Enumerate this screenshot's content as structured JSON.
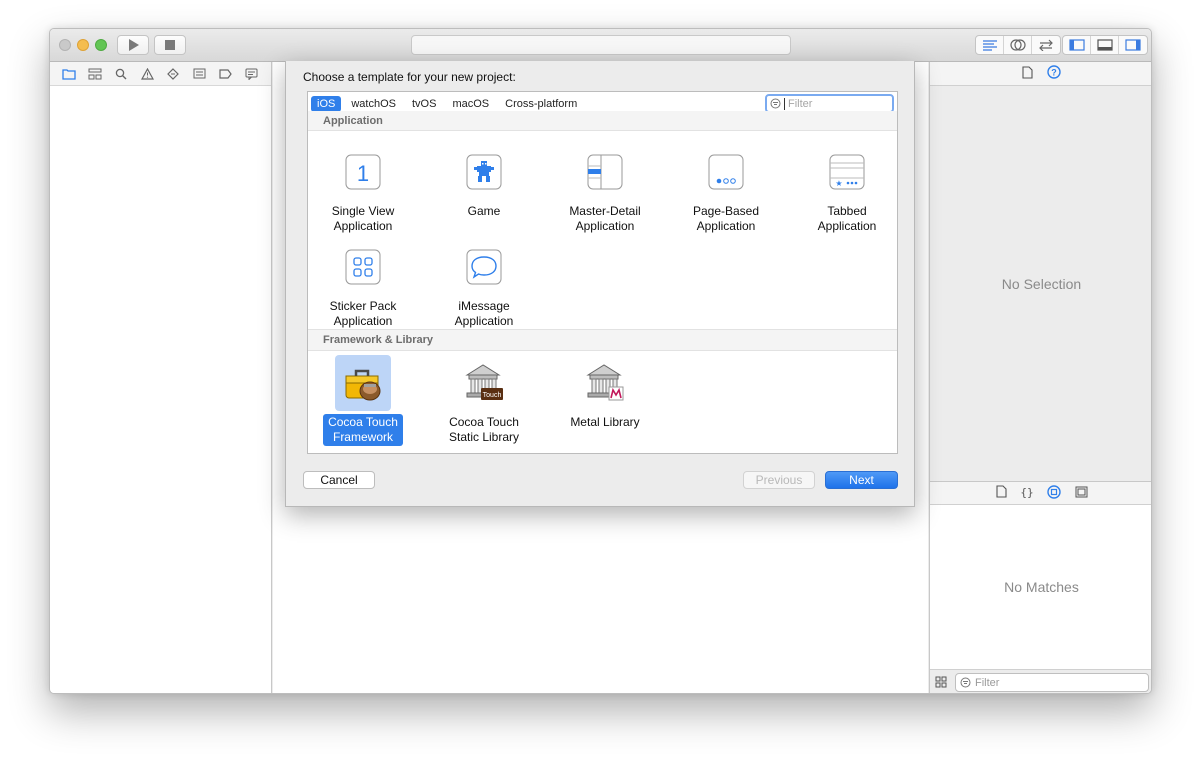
{
  "sheet": {
    "title": "Choose a template for your new project:",
    "tabs": [
      {
        "label": "iOS",
        "active": true
      },
      {
        "label": "watchOS",
        "active": false
      },
      {
        "label": "tvOS",
        "active": false
      },
      {
        "label": "macOS",
        "active": false
      },
      {
        "label": "Cross-platform",
        "active": false
      }
    ],
    "filter_placeholder": "Filter",
    "sections": {
      "application": "Application",
      "framework": "Framework & Library"
    },
    "templates": {
      "single_view": "Single View\nApplication",
      "game": "Game",
      "master_detail": "Master-Detail\nApplication",
      "page_based": "Page-Based\nApplication",
      "tabbed": "Tabbed\nApplication",
      "sticker_pack": "Sticker Pack\nApplication",
      "imessage": "iMessage\nApplication",
      "cocoa_framework": "Cocoa Touch\nFramework",
      "cocoa_static": "Cocoa Touch\nStatic Library",
      "metal": "Metal Library"
    },
    "selected_template": "cocoa_framework",
    "static_lib_badge": "Touch",
    "buttons": {
      "cancel": "Cancel",
      "previous": "Previous",
      "next": "Next"
    }
  },
  "inspector": {
    "no_selection": "No Selection",
    "no_matches": "No Matches",
    "filter_placeholder": "Filter"
  },
  "colors": {
    "accent": "#2f7fea",
    "selected_bg": "#bdd5f7"
  }
}
